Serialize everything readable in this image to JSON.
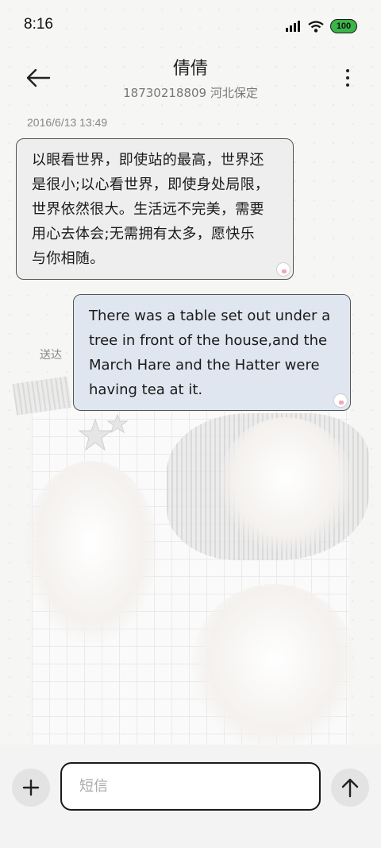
{
  "status_bar": {
    "time": "8:16",
    "battery_level": "100",
    "battery_color": "#3bb54a",
    "icons": [
      "signal-icon",
      "wifi-icon",
      "battery-icon"
    ]
  },
  "header": {
    "contact_name": "倩倩",
    "contact_subtitle": "18730218809 河北保定",
    "back_icon": "arrow-left-icon",
    "more_icon": "more-vertical-icon"
  },
  "messages": [
    {
      "direction": "incoming",
      "timestamp": "2016/6/13 13:49",
      "lines": [
        "以眼看世界，即使站的最高，世界还",
        "是很小;以心看世界，即使身处局限，",
        "世界依然很大。生活远不完美，需要",
        "用心去体会;无需拥有太多，愿快乐",
        "与你相随。"
      ],
      "bubble_color": "#eeeeee"
    },
    {
      "direction": "outgoing",
      "status": "送达",
      "lines": [
        "There was a table set out under a",
        "tree in front of the house,and the",
        "March Hare and the Hatter were",
        "having tea at it."
      ],
      "bubble_color": "#dfe6ef"
    }
  ],
  "composer": {
    "placeholder": "短信",
    "value": "",
    "add_icon": "plus-icon",
    "send_icon": "arrow-up-icon"
  }
}
